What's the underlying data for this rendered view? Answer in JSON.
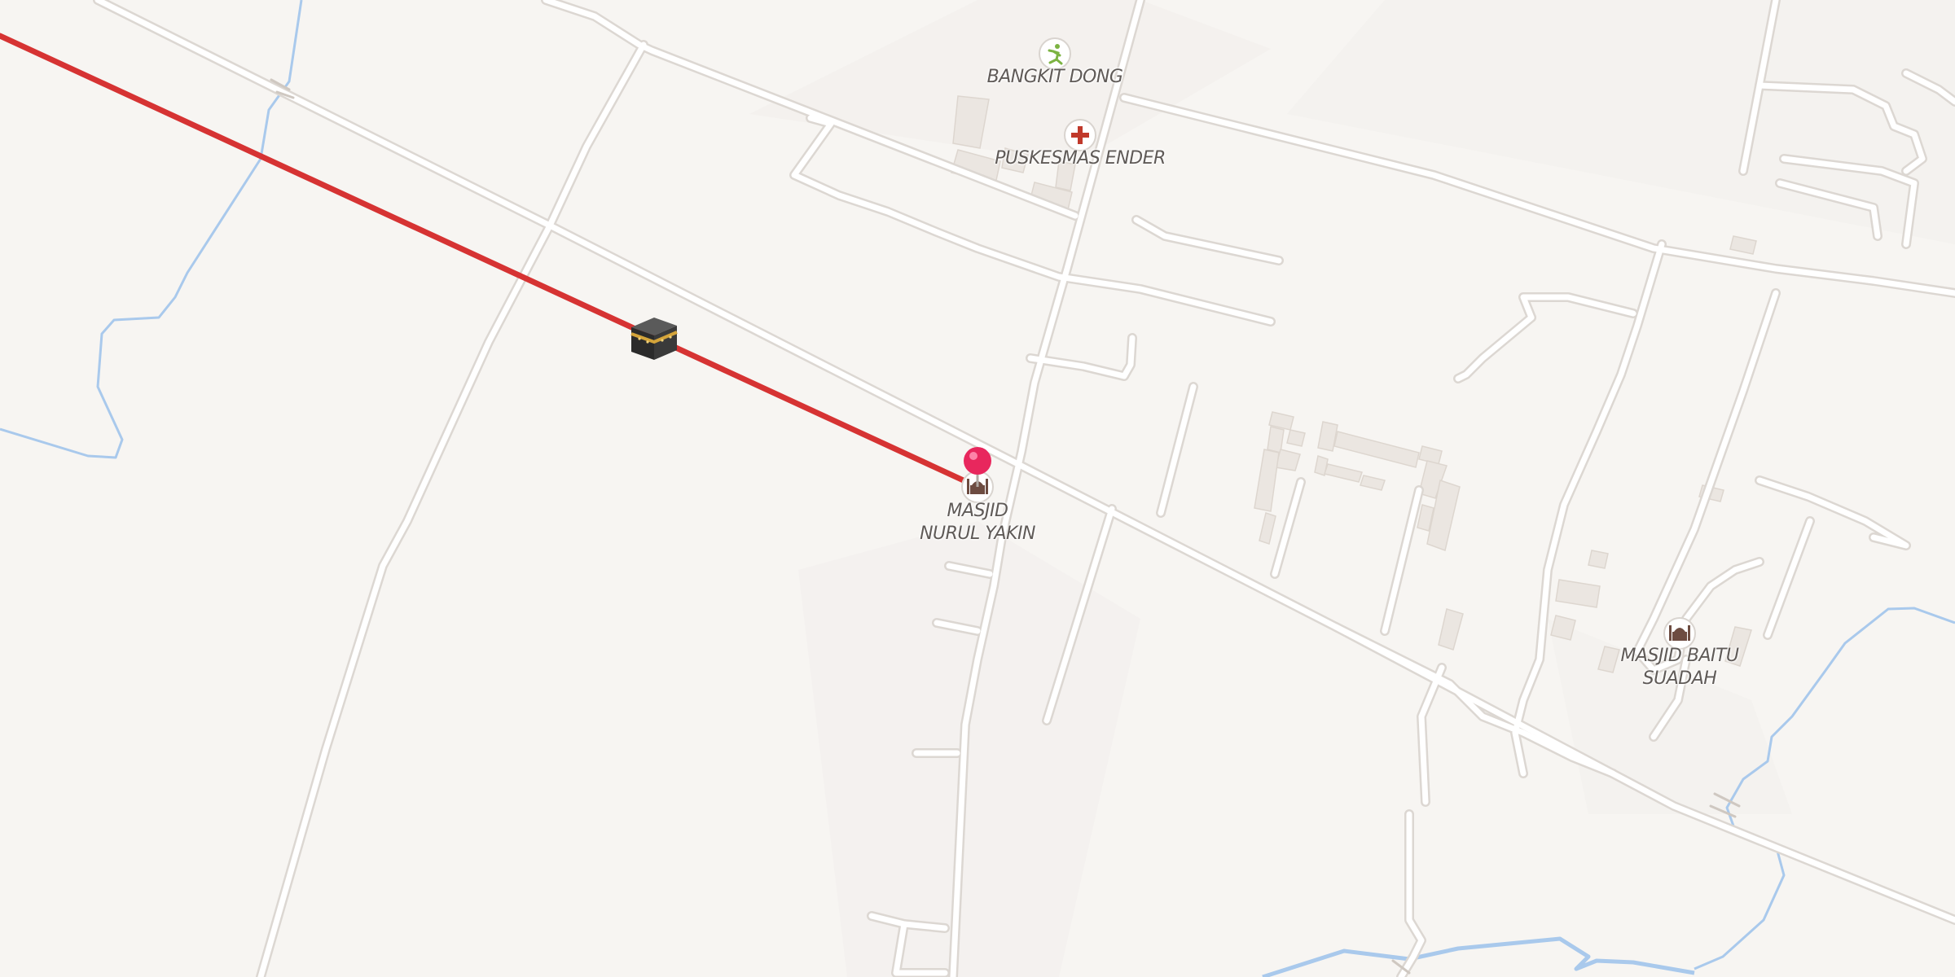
{
  "map": {
    "pois": [
      {
        "id": "bangkit-dong",
        "label": "BANGKIT DONG",
        "icon": "sports-runner-icon",
        "color": "#7cb342"
      },
      {
        "id": "puskesmas-ender",
        "label": "PUSKESMAS ENDER",
        "icon": "medical-cross-icon",
        "color": "#c0392b"
      },
      {
        "id": "masjid-nurul-yakin",
        "label": "MASJID\nNURUL YAKIN",
        "icon": "mosque-icon",
        "color": "#6d4c41"
      },
      {
        "id": "masjid-baitu-suadah",
        "label": "MASJID BAITU\nSUADAH",
        "icon": "mosque-icon",
        "color": "#6d4c41"
      }
    ],
    "qibla_line_color": "#d63333",
    "kaaba_marker": "kaaba-icon",
    "location_pin": {
      "icon": "location-pin-icon",
      "color": "#e8275d"
    },
    "water_color": "#a9c9ec",
    "road_color": "#ffffff",
    "road_casing_color": "#dedad6"
  }
}
